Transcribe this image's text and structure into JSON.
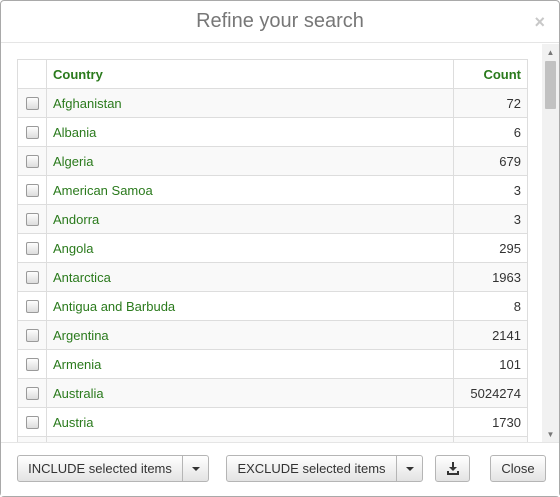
{
  "dialog": {
    "title": "Refine your search",
    "close_glyph": "×"
  },
  "table": {
    "headers": {
      "country": "Country",
      "count": "Count"
    },
    "rows": [
      {
        "country": "Afghanistan",
        "count": "72"
      },
      {
        "country": "Albania",
        "count": "6"
      },
      {
        "country": "Algeria",
        "count": "679"
      },
      {
        "country": "American Samoa",
        "count": "3"
      },
      {
        "country": "Andorra",
        "count": "3"
      },
      {
        "country": "Angola",
        "count": "295"
      },
      {
        "country": "Antarctica",
        "count": "1963"
      },
      {
        "country": "Antigua and Barbuda",
        "count": "8"
      },
      {
        "country": "Argentina",
        "count": "2141"
      },
      {
        "country": "Armenia",
        "count": "101"
      },
      {
        "country": "Australia",
        "count": "5024274"
      },
      {
        "country": "Austria",
        "count": "1730"
      },
      {
        "country": "",
        "count": ""
      }
    ]
  },
  "footer": {
    "include_label": "INCLUDE selected items",
    "exclude_label": "EXCLUDE selected items",
    "close_label": "Close",
    "download_icon": "download-icon"
  },
  "colors": {
    "link_green": "#2a7a1c",
    "title_gray": "#777777",
    "row_stripe": "#f9f9f9"
  }
}
